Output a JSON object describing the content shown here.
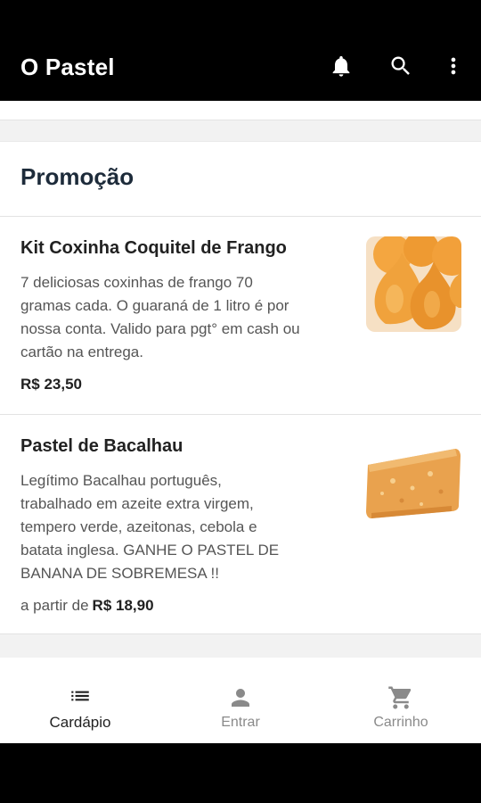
{
  "appbar": {
    "title": "O Pastel",
    "actions": [
      {
        "name": "bell-icon"
      },
      {
        "name": "search-icon"
      },
      {
        "name": "more-vert-icon"
      }
    ]
  },
  "section": {
    "title": "Promoção",
    "items": [
      {
        "name": "Kit Coxinha Coquitel de Frango",
        "description_lines": [
          "7 deliciosas coxinhas de frango 70",
          "gramas cada. O guaraná de 1 litro é por",
          "nossa conta. Valido para pgt° em cash ou",
          "cartão na entrega."
        ],
        "price_prefix": "",
        "price": "R$ 23,50",
        "image": "coxinha-photo"
      },
      {
        "name": "Pastel de Bacalhau",
        "description_lines": [
          "Legítimo Bacalhau português,",
          "trabalhado em azeite extra virgem,",
          "tempero verde, azeitonas, cebola e",
          "batata inglesa. GANHE O PASTEL DE",
          "BANANA DE SOBREMESA !!"
        ],
        "price_prefix": "a partir de",
        "price": "R$ 18,90",
        "image": "pastel-photo"
      }
    ]
  },
  "bottom_nav": {
    "items": [
      {
        "label": "Cardápio",
        "icon": "list-icon",
        "active": true
      },
      {
        "label": "Entrar",
        "icon": "person-icon",
        "active": false
      },
      {
        "label": "Carrinho",
        "icon": "cart-icon",
        "active": false
      }
    ]
  },
  "colors": {
    "appbar": "#000000",
    "active_nav": "#222222",
    "inactive_nav": "#8a8a8a"
  }
}
